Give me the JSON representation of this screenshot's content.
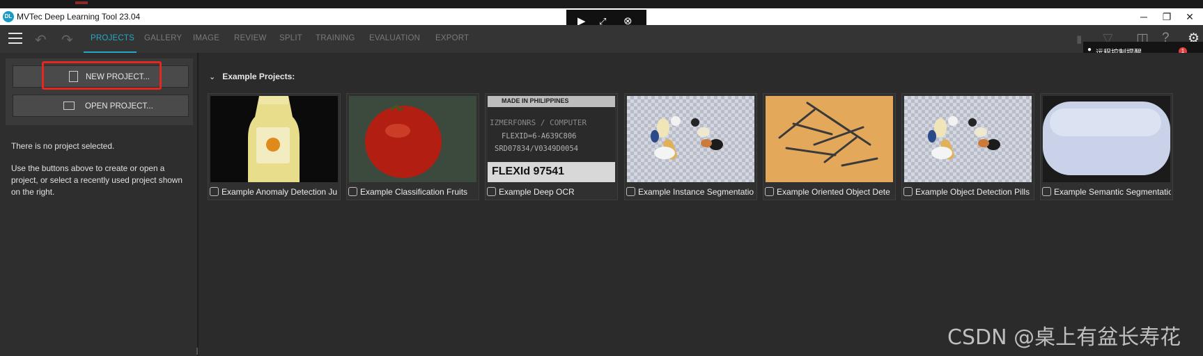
{
  "window": {
    "title": "MVTec Deep Learning Tool 23.04",
    "logo_text": "DL"
  },
  "remote_control": {
    "icons": [
      "play-cursor-icon",
      "fit-screen-icon",
      "close-circle-icon"
    ]
  },
  "toolbar": {
    "tabs": [
      "PROJECTS",
      "GALLERY",
      "IMAGE",
      "REVIEW",
      "SPLIT",
      "TRAINING",
      "EVALUATION",
      "EXPORT"
    ],
    "active_tab": "PROJECTS"
  },
  "notification": {
    "text": "远程控制提醒",
    "badge": "1"
  },
  "sidebar": {
    "new_project": "NEW PROJECT...",
    "open_project": "OPEN PROJECT...",
    "no_project": "There is no project selected.",
    "hint": "Use the buttons above to create or open a project, or select a recently used project shown on the right."
  },
  "main": {
    "section_title": "Example Projects:",
    "projects": [
      {
        "label": "Example Anomaly Detection Ju",
        "icon": "anomaly-icon"
      },
      {
        "label": "Example Classification Fruits",
        "icon": "classification-icon"
      },
      {
        "label": "Example Deep OCR",
        "icon": "ocr-icon",
        "thumb_text": [
          "MADE IN PHILIPPINES",
          "IZMERFONRS / COMPUTER",
          "FLEXID=6-A639C806",
          "SRD07834/V0349D0054",
          "FLEXId 97541"
        ]
      },
      {
        "label": "Example Instance Segmentatio",
        "icon": "instance-seg-icon"
      },
      {
        "label": "Example Oriented Object Dete",
        "icon": "oriented-detection-icon"
      },
      {
        "label": "Example Object Detection Pills",
        "icon": "object-detection-icon"
      },
      {
        "label": "Example Semantic Segmentatio",
        "icon": "semantic-seg-icon"
      }
    ]
  },
  "watermark": "CSDN @桌上有盆长寿花",
  "colors": {
    "accent": "#25a8c8",
    "highlight": "#e5281f",
    "background": "#2b2b2b"
  }
}
